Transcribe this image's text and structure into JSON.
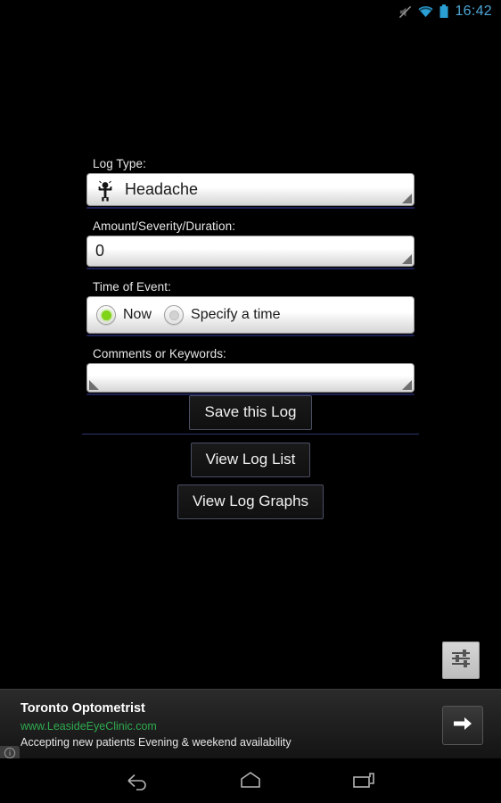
{
  "status_bar": {
    "icons": [
      "mute-icon",
      "wifi-icon",
      "battery-icon"
    ],
    "time": "16:42",
    "accent_color": "#4ea6d6"
  },
  "form": {
    "log_type": {
      "label": "Log Type:",
      "icon": "person-headache-icon",
      "value": "Headache",
      "dropdown_indicator": "spinner-triangle-icon"
    },
    "amount": {
      "label": "Amount/Severity/Duration:",
      "value": "0",
      "placeholder": ""
    },
    "time_of_event": {
      "label": "Time of Event:",
      "options": [
        {
          "label": "Now",
          "selected": true
        },
        {
          "label": "Specify a time",
          "selected": false
        }
      ],
      "selected_color": "#7fd318"
    },
    "comments": {
      "label": "Comments or Keywords:",
      "value": "",
      "placeholder": ""
    }
  },
  "buttons": {
    "save": "Save this Log",
    "view_list": "View Log List",
    "view_graphs": "View Log Graphs"
  },
  "settings_fab": {
    "icon": "sliders-settings-icon"
  },
  "ad": {
    "title": "Toronto Optometrist",
    "url": "www.LeasideEyeClinic.com",
    "description": "Accepting new patients Evening & weekend availability",
    "cta_icon": "arrow-right-icon",
    "info_icon": "info-icon",
    "url_color": "#2eab4f"
  },
  "nav_bar": {
    "back": "back-icon",
    "home": "home-icon",
    "recents": "recents-icon"
  }
}
